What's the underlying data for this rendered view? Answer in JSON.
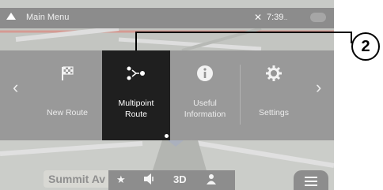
{
  "status_bar": {
    "title": "Main Menu",
    "time": "7:39",
    "time_suffix": "..."
  },
  "menu": {
    "items": [
      {
        "label": "New Route",
        "icon": "checkered-flag-icon",
        "selected": false
      },
      {
        "label": "Multipoint\nRoute",
        "icon": "multipoint-route-icon",
        "selected": true
      },
      {
        "label": "Useful\nInformation",
        "icon": "info-icon",
        "selected": false
      },
      {
        "label": "Settings",
        "icon": "gear-icon",
        "selected": false
      }
    ]
  },
  "map": {
    "street_label": "Summit Av"
  },
  "bottom_bar": {
    "view_mode": "3D"
  },
  "callout": {
    "number": "2"
  }
}
